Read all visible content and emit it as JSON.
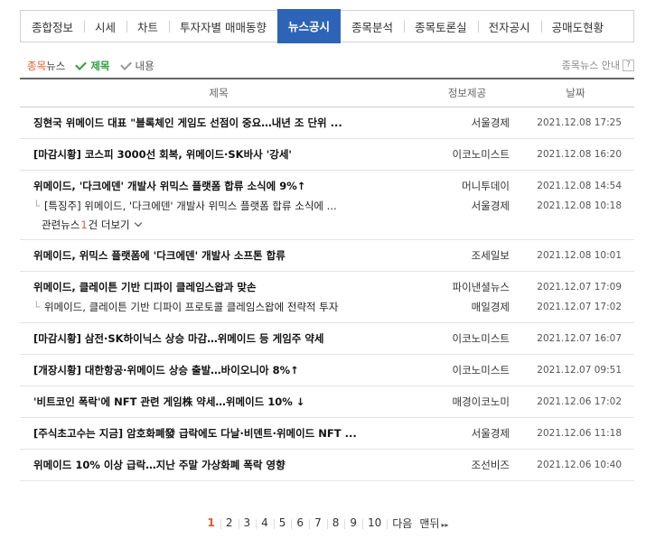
{
  "tabs": [
    {
      "label": "종합정보",
      "active": false
    },
    {
      "label": "시세",
      "active": false
    },
    {
      "label": "차트",
      "active": false
    },
    {
      "label": "투자자별 매매동향",
      "active": false
    },
    {
      "label": "뉴스공시",
      "active": true
    },
    {
      "label": "종목분석",
      "active": false
    },
    {
      "label": "종목토론실",
      "active": false
    },
    {
      "label": "전자공시",
      "active": false
    },
    {
      "label": "공매도현황",
      "active": false
    }
  ],
  "filter": {
    "news_prefix": "종목",
    "news_suffix": "뉴스",
    "title_label": "제목",
    "content_label": "내용",
    "guide_label": "종목뉴스 안내",
    "help_glyph": "?"
  },
  "table": {
    "headers": {
      "title": "제목",
      "source": "정보제공",
      "date": "날짜"
    },
    "groups": [
      {
        "rows": [
          {
            "title": "징현국 위메이드 대표 \"블록체인 게임도 선점이 중요…내년 조 단위 ...",
            "source": "서울경제",
            "date": "2021.12.08 17:25"
          }
        ]
      },
      {
        "rows": [
          {
            "title": "[마감시황] 코스피 3000선 회복, 위메이드·SK바사 '강세'",
            "source": "이코노미스트",
            "date": "2021.12.08 16:20"
          }
        ]
      },
      {
        "rows": [
          {
            "title": "위메이드, '다크에덴' 개발사 위믹스 플랫폼 합류 소식에 9%↑",
            "source": "머니투데이",
            "date": "2021.12.08 14:54"
          },
          {
            "title": "[특징주] 위메이드, '다크에덴' 개발사 위믹스 플랫폼 합류 소식에 ...",
            "source": "서울경제",
            "date": "2021.12.08 10:18"
          }
        ],
        "more": {
          "prefix": "관련뉴스 ",
          "count": "1",
          "suffix": "건 더보기"
        }
      },
      {
        "rows": [
          {
            "title": "위메이드, 위믹스 플랫폼에 '다크에덴' 개발사 소프톤 합류",
            "source": "조세일보",
            "date": "2021.12.08 10:01"
          }
        ]
      },
      {
        "rows": [
          {
            "title": "위메이드, 클레이튼 기반 디파이 클레임스왑과 맞손",
            "source": "파이낸셜뉴스",
            "date": "2021.12.07 17:09"
          },
          {
            "title": "위메이드, 클레이튼 기반 디파이 프로토콜 클레임스왑에 전략적 투자",
            "source": "매일경제",
            "date": "2021.12.07 17:02"
          }
        ]
      },
      {
        "rows": [
          {
            "title": "[마감시황] 삼전·SK하이닉스 상승 마감…위메이드 등 게임주 약세",
            "source": "이코노미스트",
            "date": "2021.12.07 16:07"
          }
        ]
      },
      {
        "rows": [
          {
            "title": "[개장시황] 대한항공·위메이드 상승 출발…바이오니아 8%↑",
            "source": "이코노미스트",
            "date": "2021.12.07 09:51"
          }
        ]
      },
      {
        "rows": [
          {
            "title": "'비트코인 폭락'에 NFT 관련 게임株 약세…위메이드 10% ↓",
            "source": "매경이코노미",
            "date": "2021.12.06 17:02"
          }
        ]
      },
      {
        "rows": [
          {
            "title": "[주식초고수는 지금] 암호화폐發 급락에도 다날·비덴트·위메이드 NFT ...",
            "source": "서울경제",
            "date": "2021.12.06 11:18"
          }
        ]
      },
      {
        "rows": [
          {
            "title": "위메이드 10% 이상 급락…지난 주말 가상화폐 폭락 영향",
            "source": "조선비즈",
            "date": "2021.12.06 10:40"
          }
        ]
      }
    ]
  },
  "pagination": {
    "pages": [
      "1",
      "2",
      "3",
      "4",
      "5",
      "6",
      "7",
      "8",
      "9",
      "10"
    ],
    "current": "1",
    "next_label": "다음",
    "last_label": "맨뒤",
    "last_arrows": "▸▸"
  },
  "colors": {
    "accent": "#2e64b8",
    "highlight": "#e05a2b",
    "check": "#2e9e3c"
  },
  "icons": {
    "check": "check-icon",
    "chevron": "chevron-down-icon",
    "help": "help-icon"
  }
}
